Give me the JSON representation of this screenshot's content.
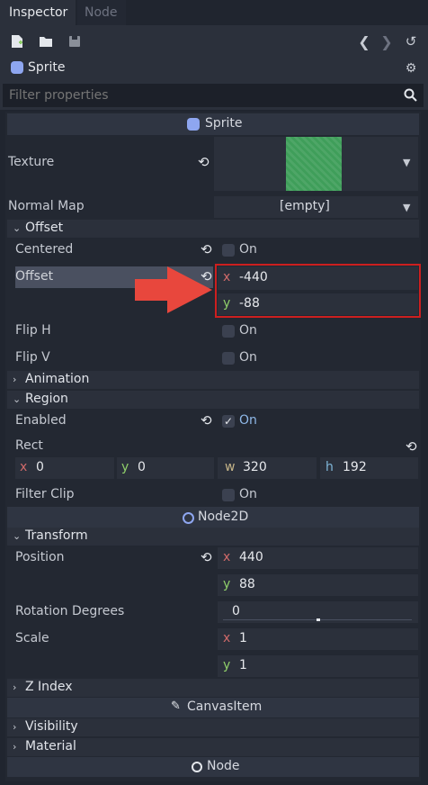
{
  "tabs": [
    {
      "label": "Inspector"
    },
    {
      "label": "Node"
    }
  ],
  "object": {
    "name": "Sprite"
  },
  "filter": {
    "placeholder": "Filter properties"
  },
  "categories": {
    "sprite": "Sprite",
    "node2d": "Node2D",
    "canvas_item": "CanvasItem",
    "node": "Node"
  },
  "props": {
    "texture": "Texture",
    "normal_map": "Normal Map",
    "normal_map_value": "[empty]",
    "offset_section": "Offset",
    "centered": "Centered",
    "centered_value": "On",
    "offset": "Offset",
    "offset_x": "-440",
    "offset_y": "-88",
    "flip_h": "Flip H",
    "flip_h_value": "On",
    "flip_v": "Flip V",
    "flip_v_value": "On",
    "animation": "Animation",
    "region": "Region",
    "enabled": "Enabled",
    "enabled_value": "On",
    "rect": "Rect",
    "rect_x": "0",
    "rect_y": "0",
    "rect_w": "320",
    "rect_h": "192",
    "filter_clip": "Filter Clip",
    "filter_clip_value": "On",
    "transform": "Transform",
    "position": "Position",
    "position_x": "440",
    "position_y": "88",
    "rotation": "Rotation Degrees",
    "rotation_value": "0",
    "scale": "Scale",
    "scale_x": "1",
    "scale_y": "1",
    "z_index": "Z Index",
    "visibility": "Visibility",
    "material": "Material"
  },
  "axes": {
    "x": "x",
    "y": "y",
    "w": "w",
    "h": "h"
  },
  "colors": {
    "highlight": "#cc1f1f",
    "arrow": "#e8473d",
    "texture": "#3f9e5a",
    "enabled": "#8fb8e8"
  }
}
